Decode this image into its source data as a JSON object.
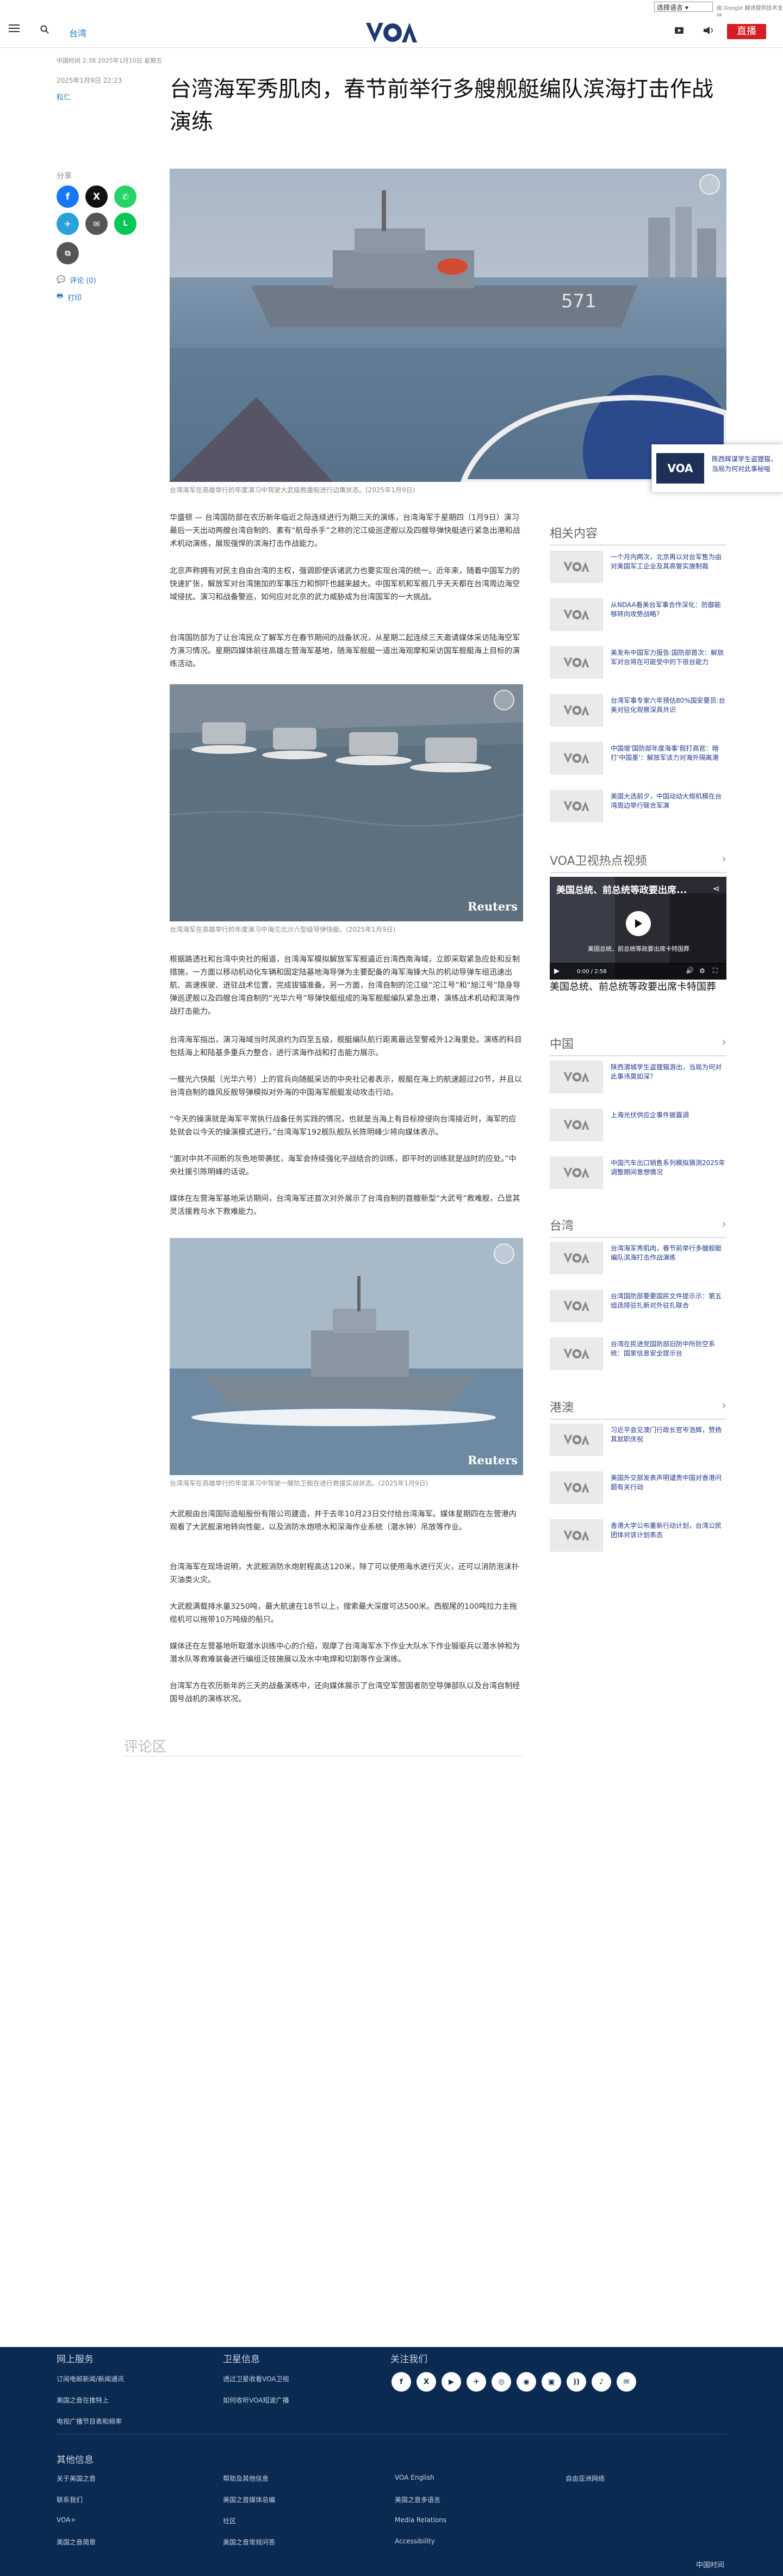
{
  "topbar": {
    "lang_select": "选择语言 ▾",
    "gt_label": "由 Google 翻译提供技术支持"
  },
  "header": {
    "nav_current": "台湾",
    "live": "直播",
    "logo": "VOA"
  },
  "article": {
    "top_meta": "中国时间 2:38 2025年1月10日 星期五",
    "date": "2025年1月9日 22:23",
    "author": "粒仁",
    "title": "台湾海军秀肌肉，春节前举行多艘舰艇编队滨海打击作战演练",
    "share_label": "分享",
    "comments_link": "评论 (0)",
    "print_link": "打印",
    "cap1": "台湾海军在高雄举行的年度演习中驾驶大武级救援船进行边鹰状态。(2025年1月9日)",
    "p1": "华盛顿 — 台湾国防部在农历新年临近之际连续进行为期三天的演练，台湾海军于星期四（1月9日）演习最后一天出动两艘台湾自制的、素有“航母杀手”之称的沱江级巡逻舰以及四艘导弹快艇进行紧急出港和战术机动演练，展现强悍的滨海打击作战能力。",
    "p2": "北京声称拥有对民主自由台湾的主权，强调即使诉诸武力也要实现台湾的统一。近年来，随着中国军力的快速扩张，解放军对台湾施加的军事压力和恫吓也越来越大。中国军机和军舰几乎天天都在台湾周边海空域侵扰。演习和战备警巡，如何应对北京的武力威胁成为台湾国军的一大挑战。",
    "p3": "台湾国防部为了让台湾民众了解军方在春节期间的战备状况，从星期二起连续三天邀请媒体采访陆海空军方演习情况。星期四媒体前往高雄左营海军基地，随海军舰艇一道出海观摩和采访国军舰艇海上目标的演练活动。",
    "cap2": "台湾海军在高雄举行的年度演习中海沱北沙六型级导弹快艇。(2025年1月9日)",
    "p4": "根据路透社和台湾中央社的报道，台湾海军模拟解放军军舰逼近台湾西南海域，立即采取紧急应处和反制措施，一方面以移动机动化车辆和固定陆基地海导弹为主要配备的海军海锋大队的机动导弹车组迅速出航、高速疾驶、进驻战术位置，完成拔锚准备。另一方面，台湾自制的沱江级“沱江号”和“旭江号”隐身导弹巡逻舰以及四艘台湾自制的“光华六号”导弹快艇组成的海军舰艇编队紧急出港，演练战术机动和滨海作战打击能力。",
    "p5": "台湾海军指出，演习海域当时风浪约为四至五级，舰艇编队航行距离最远至警戒外12海里处。演练的科目包括海上和陆基多重兵力整合，进行滨海作战和打击能力展示。",
    "p6": "一艘光六快艇（光华六号）上的官兵向随艇采访的中央社记者表示，舰艇在海上的航速超过20节，并且以台湾自制的雄风反舰导弹模拟对外海的中国海军舰艇发动攻击行动。",
    "p7": "“今天的操演就是海军平常执行战备任务实践的情况，也就是当海上有目标掠侵向台湾接近时，海军的应处就会以今天的操演模式进行。”台湾海军192舰队舰队长陈明峰少将向媒体表示。",
    "p8": "“面对中共不间断的灰色地带袭扰，海军会持续强化平战结合的训练，即平时的训练就是战时的应处。”中央社援引陈明峰的话说。",
    "p9": "媒体在左营海军基地采访期间，台湾海军还首次对外展示了台湾自制的首艘新型“大武号”救难舰，凸显其灵活援救与水下救难能力。",
    "cap3": "台湾海军在高雄举行的年度演习中驾驶一艘防卫舰在进行救援实战状态。(2025年1月9日)",
    "p10": "大武舰由台湾国际造船股份有限公司建造，并于去年10月23日交付给台湾海军。媒体星期四在左营港内观看了大武舰滚地转向性能，以及消防水炮喷水和深海作业系统（潜水钟）吊放等作业。",
    "p11": "台湾海军在现场说明，大武舰消防水炮射程高达120米，除了可以使用海水进行灭火，还可以消防泡沫扑灭油类火灾。",
    "p12": "大武舰满载排水量3250吨，最大航速在18节以上，搜索最大深度可达500米。西舰尾的100吨拉力主拖缆机可以拖带10万吨级的船只。",
    "p13": "媒体还在左营基地听取潜水训练中心的介绍，观摩了台湾海军水下作业大队水下作业锻驱兵以潜水钟和为潜水队等救难装备进行编组泛技施展以及水中电焊和切割等作业演练。",
    "p14": "台湾军方在农历新年的三天的战备演练中，还向媒体展示了台湾空军营国者防空导弹部队以及台湾自制经国号战机的演练状况。",
    "comments_heading": "评论区"
  },
  "float_card": {
    "text": "陈西辉谋学生盗狸猫，当局为何对此事秘嗌"
  },
  "sidebar": {
    "related_heading": "相关内容",
    "related": [
      "一个月内两次，北京再以对台军售为由对美国军工企业及其高管实施制裁",
      "从NDAA看美台军事合作深化：防御能够转向攻势战略？",
      "美发布中国军力报告:国防部首次：解放军对台将在可能受中的下很台能力",
      "台湾军事专家六年预估80%国安要员:台美对驻化观察深具共识",
      "中国增'国防部年度海事'假打高官：暗打'中国墨'：解放军该力对海外隔离港",
      "美国大选前夕，中国动动大规机模在台湾周边举行联合军演"
    ],
    "video_heading": "VOA卫视热点视频",
    "video_title": "美国总统、前总统等政要出席卡特国葬",
    "video_overlay_title": "美国总统、前总统等政要出席...",
    "video_subtitle": "美国总统、前总统等政要出席卡特国葬",
    "video_time": "0:00 / 2:58",
    "china_heading": "中国",
    "china": [
      "陕西渭城学生盗狸猫游出，当局为何对此事讳莫如深？",
      "上海光伏供应企事件披露调",
      "中国汽车出口销售系列模拟猜测2025年调整期间意想情况"
    ],
    "taiwan_heading": "台湾",
    "taiwan": [
      "台湾海军秀肌肉，春节前举行多艘舰艇编队滨海打击作战演练",
      "台湾国防部要要国民文件提示示：第五组选择驻扎新对外驻扎联合",
      "台湾在民进党国防部旧防中所防空系统：国家信息安全提示台"
    ],
    "hk_heading": "港澳",
    "hk": [
      "习近平会见澳门行政长官岑浩辉，赞扬其就职庆祝",
      "美国外交部发表声明谴责中国对香港问题有关行动",
      "香港大学公布重新行动计划，台湾公民团体对该计划表态"
    ]
  },
  "footer": {
    "col1_heading": "网上服务",
    "col1": [
      "订阅电邮新闻/新闻通讯",
      "美国之音在推特上",
      "电视广播节目表和频率"
    ],
    "col2_heading": "卫星信息",
    "col2": [
      "透过卫星收看VOA卫视",
      "如何收听VOA短波广播"
    ],
    "col3_heading": "关注我们",
    "social": [
      "f",
      "X",
      "▶",
      "✈",
      "◎",
      "◉",
      "▣",
      "))",
      "♪",
      "✉"
    ],
    "other_heading": "其他信息",
    "other_col1": [
      "关于美国之音",
      "联系我们",
      "VOA+",
      "美国之音简章"
    ],
    "other_col2": [
      "帮助及其他信息",
      "美国之音媒体总编",
      "社区",
      "美国之音常规问答"
    ],
    "other_col3": [
      "VOA English",
      "美国之音多语言",
      "Media Relations",
      "Accessibility"
    ],
    "other_col4": [
      "自由亚洲网络"
    ],
    "lang_switch": "中国时间"
  }
}
